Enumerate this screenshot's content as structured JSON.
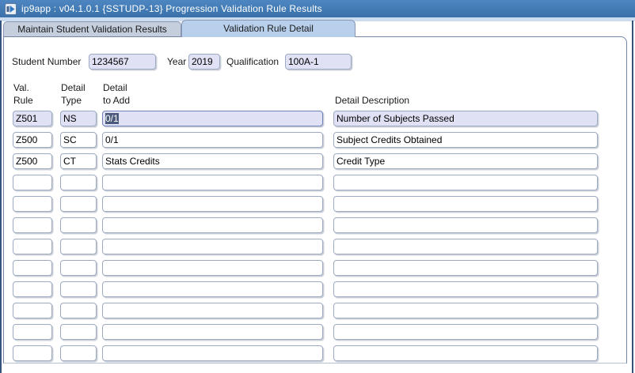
{
  "window": {
    "title": "ip9app : v04.1.0.1 {SSTUDP-13} Progression Validation Rule Results"
  },
  "icons": {
    "app_icon": "forms-runtime-application-icon"
  },
  "tabs": {
    "inactive": "Maintain Student Validation Results",
    "active": "Validation Rule Detail"
  },
  "form": {
    "student_number_label": "Student Number",
    "student_number_value": "1234567",
    "year_label": "Year",
    "year_value": "2019",
    "qualification_label": "Qualification",
    "qualification_value": "100A-1"
  },
  "grid": {
    "headers": {
      "col1_line1": "Val.",
      "col1_line2": "Rule",
      "col2_line1": "Detail",
      "col2_line2": "Type",
      "col3_line1": "Detail",
      "col3_line2": "to Add",
      "col4": "Detail Description"
    },
    "rows": [
      {
        "val_rule": "Z501",
        "detail_type": "NS",
        "detail_to_add": "0/1",
        "description": "Number of Subjects Passed",
        "current": true
      },
      {
        "val_rule": "Z500",
        "detail_type": "SC",
        "detail_to_add": "0/1",
        "description": "Subject Credits Obtained",
        "current": false
      },
      {
        "val_rule": "Z500",
        "detail_type": "CT",
        "detail_to_add": "Stats Credits",
        "description": "Credit Type",
        "current": false
      },
      {
        "val_rule": "",
        "detail_type": "",
        "detail_to_add": "",
        "description": "",
        "current": false
      },
      {
        "val_rule": "",
        "detail_type": "",
        "detail_to_add": "",
        "description": "",
        "current": false
      },
      {
        "val_rule": "",
        "detail_type": "",
        "detail_to_add": "",
        "description": "",
        "current": false
      },
      {
        "val_rule": "",
        "detail_type": "",
        "detail_to_add": "",
        "description": "",
        "current": false
      },
      {
        "val_rule": "",
        "detail_type": "",
        "detail_to_add": "",
        "description": "",
        "current": false
      },
      {
        "val_rule": "",
        "detail_type": "",
        "detail_to_add": "",
        "description": "",
        "current": false
      },
      {
        "val_rule": "",
        "detail_type": "",
        "detail_to_add": "",
        "description": "",
        "current": false
      },
      {
        "val_rule": "",
        "detail_type": "",
        "detail_to_add": "",
        "description": "",
        "current": false
      },
      {
        "val_rule": "",
        "detail_type": "",
        "detail_to_add": "",
        "description": "",
        "current": false
      }
    ],
    "focused": {
      "row": 0,
      "col": "detail_to_add"
    }
  },
  "colors": {
    "titlebar": "#3b76b2",
    "tab_active": "#b8d0ec",
    "tab_inactive": "#c4cedd",
    "field_highlight": "#e0e1f5",
    "selection": "#4c5b7d"
  }
}
